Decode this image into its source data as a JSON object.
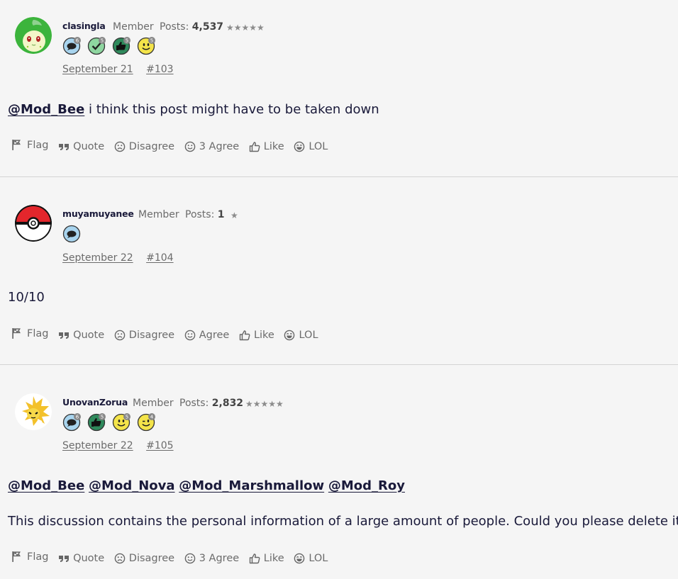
{
  "posts": [
    {
      "username": "clasingla",
      "role": "Member",
      "posts_label": "Posts:",
      "posts_count": "4,537",
      "stars": "★★★★★",
      "date": "September 21",
      "post_number": "#103",
      "badges": [
        {
          "icon": "speech-bubble-icon",
          "count": "6",
          "color": "#a8d4ee"
        },
        {
          "icon": "check-icon",
          "count": "5",
          "color": "#8ed6a0"
        },
        {
          "icon": "thumbs-up-icon",
          "count": "5",
          "color": "#2f8a5c"
        },
        {
          "icon": "smiley-icon",
          "count": "5",
          "color": "#f4e44a"
        }
      ],
      "mentions": [
        "@Mod_Bee"
      ],
      "text": " i think this post might have to be taken down",
      "actions": {
        "flag": "Flag",
        "quote": "Quote",
        "disagree": "Disagree",
        "agree": "3 Agree",
        "like": "Like",
        "lol": "LOL"
      }
    },
    {
      "username": "muyamuyanee",
      "role": "Member",
      "posts_label": "Posts:",
      "posts_count": "1",
      "stars": "★",
      "date": "September 22",
      "post_number": "#104",
      "badges": [
        {
          "icon": "speech-bubble-icon",
          "count": "",
          "color": "#a8d4ee"
        }
      ],
      "text": "10/10",
      "actions": {
        "flag": "Flag",
        "quote": "Quote",
        "disagree": "Disagree",
        "agree": "Agree",
        "like": "Like",
        "lol": "LOL"
      }
    },
    {
      "username": "UnovanZorua",
      "role": "Member",
      "posts_label": "Posts:",
      "posts_count": "2,832",
      "stars": "★★★★★",
      "date": "September 22",
      "post_number": "#105",
      "badges": [
        {
          "icon": "speech-bubble-icon",
          "count": "6",
          "color": "#a8d4ee"
        },
        {
          "icon": "thumbs-up-icon",
          "count": "5",
          "color": "#2f8a5c"
        },
        {
          "icon": "smiley-icon",
          "count": "5",
          "color": "#f4e44a"
        },
        {
          "icon": "wink-icon",
          "count": "4",
          "color": "#f4e44a"
        }
      ],
      "mentions": [
        "@Mod_Bee",
        "@Mod_Nova",
        "@Mod_Marshmallow",
        "@Mod_Roy"
      ],
      "text2": "This discussion contains the personal information of a large amount of people. Could you please delete it?",
      "actions": {
        "flag": "Flag",
        "quote": "Quote",
        "disagree": "Disagree",
        "agree": "3 Agree",
        "like": "Like",
        "lol": "LOL"
      }
    }
  ],
  "colors": {
    "background": "#f5f5f5",
    "text": "#1a1a3a",
    "muted": "#6b6b6b",
    "divider": "#d4d4d4"
  }
}
